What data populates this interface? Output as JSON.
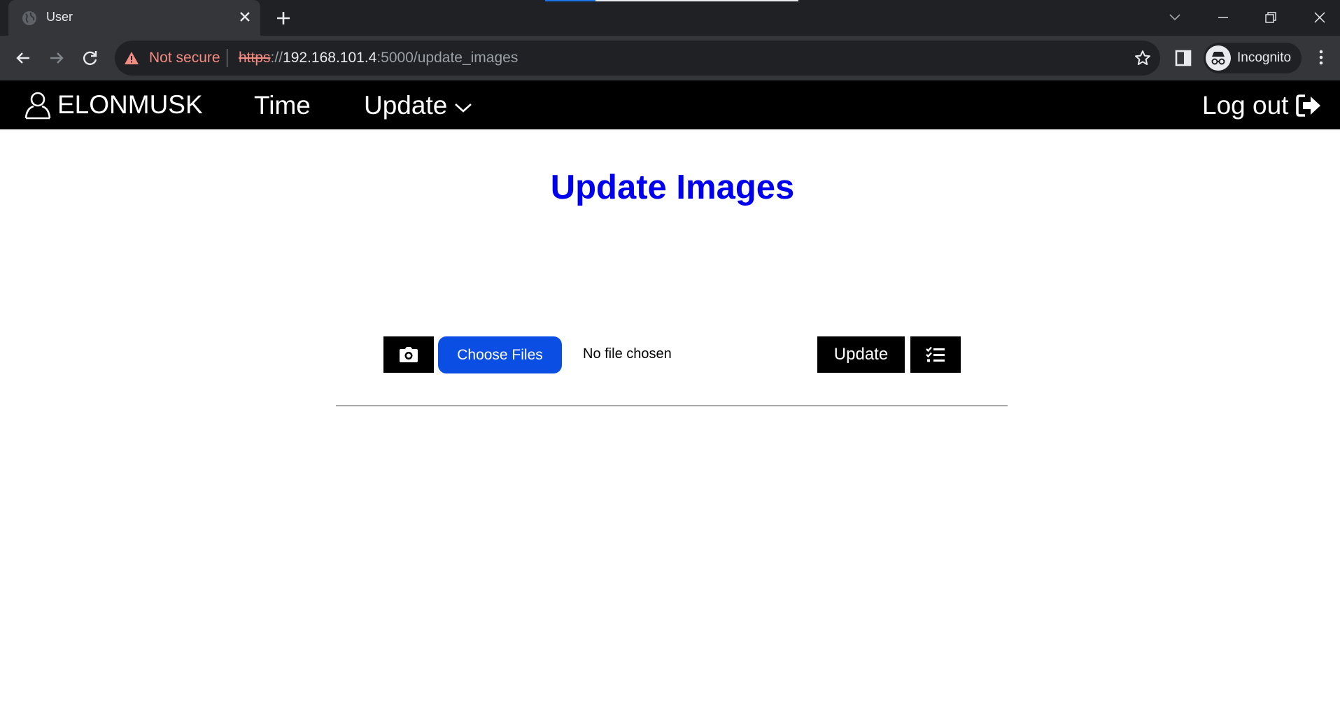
{
  "browser": {
    "tab": {
      "title": "User"
    },
    "omnibox": {
      "security_label": "Not secure",
      "url_scheme": "https",
      "url_sep": "://",
      "url_host": "192.168.101.4",
      "url_rest": ":5000/update_images"
    },
    "profile": {
      "label": "Incognito"
    }
  },
  "navbar": {
    "brand": "ELONMUSK",
    "links": {
      "time": "Time",
      "update": "Update"
    },
    "logout": "Log out"
  },
  "main": {
    "title": "Update Images",
    "file_input": {
      "button_label": "Choose Files",
      "status": "No file chosen"
    },
    "update_button": "Update"
  },
  "colors": {
    "title": "#0000ee",
    "choose_button": "#0b4ee3",
    "navbar": "#000000",
    "not_secure": "#f28b82"
  },
  "icons": {
    "user": "user-icon",
    "dropdown": "chevron-down-icon",
    "logout": "sign-out-icon",
    "camera": "camera-icon",
    "list": "list-check-icon"
  }
}
